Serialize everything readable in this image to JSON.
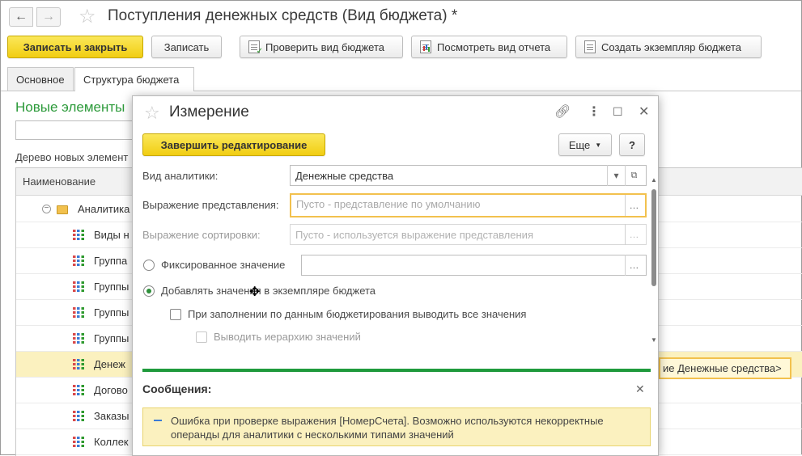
{
  "window": {
    "title": "Поступления денежных средств (Вид бюджета) *"
  },
  "toolbar": {
    "save_close": "Записать и закрыть",
    "save": "Записать",
    "check": "Проверить вид бюджета",
    "view_report": "Посмотреть вид отчета",
    "create_instance": "Создать экземпляр бюджета"
  },
  "tabs": [
    "Основное",
    "Структура бюджета"
  ],
  "new_elements": {
    "heading": "Новые элементы",
    "tree_label": "Дерево новых элемент",
    "column_name": "Наименование",
    "rows": [
      "Аналитика",
      "Виды н",
      "Группа",
      "Группы",
      "Группы",
      "Группы",
      "Денеж",
      "Догово",
      "Заказы",
      "Коллек"
    ],
    "selected_value": "ие Денежные средства>"
  },
  "dialog": {
    "title": "Измерение",
    "finish_edit": "Завершить редактирование",
    "more": "Еще",
    "help": "?",
    "analytics_label": "Вид аналитики:",
    "analytics_value": "Денежные средства",
    "repr_label": "Выражение представления:",
    "repr_placeholder": "Пусто - представление по умолчанию",
    "sort_label": "Выражение сортировки:",
    "sort_placeholder": "Пусто - используется выражение представления",
    "fixed_label": "Фиксированное значение",
    "add_values_label": "Добавлять значения в экземпляре бюджета",
    "fill_all_label": "При заполнении по данным бюджетирования выводить все значения",
    "hierarchy_label": "Выводить иерархию значений"
  },
  "messages": {
    "title": "Сообщения:",
    "error_text": "Ошибка при проверке выражения [НомерСчета]. Возможно используются некорректные операнды для аналитики с несколькими типами значений"
  },
  "colors": {
    "primary_button": "#f1cd12",
    "accent_green": "#2c9a3a",
    "message_bg": "#fbf1bf",
    "focus_border": "#f2c14e"
  }
}
